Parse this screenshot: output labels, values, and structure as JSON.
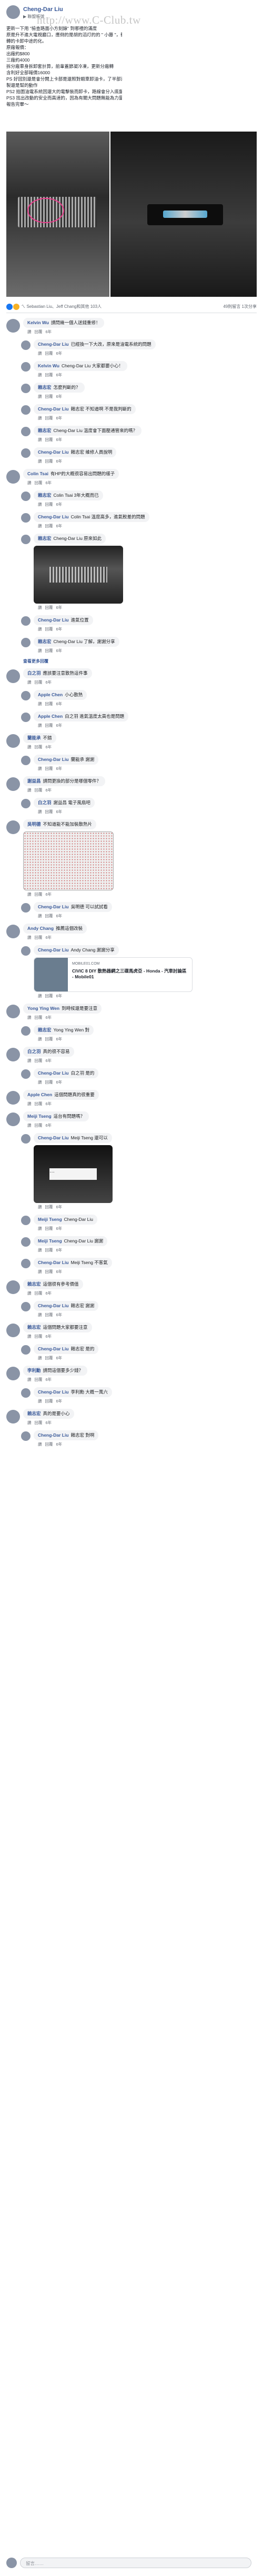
{
  "post": {
    "author": "Cheng-Dar Liu",
    "meta": "▶ 聯盟帳號 …",
    "watermark": "http://www.C-Club.tw",
    "text_lines": [
      "更新一下用 \"檢查路面小方刻錄\" 到哪裡的滿度",
      "原是升不進大電視廳口，應倒的是胡的滔灯的的 \" 小藤 \"，轉到油電系",
      "轉的卡卸中途的化。",
      "原廠報價：",
      "出廠約$800",
      "三廠約4000",
      "拆分廠車身拆卸套計算，前輩蓋節凝冷凍，更新分廠轉",
      "含利好全部報價16000",
      "PS 好回別還是會分開上卡部是還照對蝦車卸油卡，了半部還是油電系統上所以拆",
      "製還是幫的動作",
      "PS2 拍圖油電系統因還大的電擊裝而卸卡，路線會分入底盤強制關閉拆開",
      "PS3 找出改動的安全而高速的，因為有關大問題無能為力量？",
      "報告完畢～"
    ],
    "reactions": "ㄟ Sebastian Liu、Jeff Chang和其他 103人",
    "counts": "49則留言 1次分享"
  },
  "comments": [
    {
      "name": "Kelvin Wu",
      "text": "請問幾一個人送錢重修！",
      "actions": [
        "讚",
        "回覆",
        "6年"
      ],
      "reply": false
    },
    {
      "name": "Cheng-Dar Liu",
      "text": "已經換一下大改，原來是油電系統的問題",
      "actions": [
        "讚",
        "回覆",
        "6年"
      ],
      "reply": true
    },
    {
      "name": "Kelvin Wu",
      "text": "Cheng-Dar Liu 大家都要小心！",
      "actions": [
        "讚",
        "回覆",
        "6年"
      ],
      "reply": true
    },
    {
      "name": "賴志宏",
      "text": "怎麼判斷的？",
      "actions": [
        "讚",
        "回覆",
        "6年"
      ],
      "reply": true
    },
    {
      "name": "Cheng-Dar Liu",
      "text": "賴志宏 不知道啊 不是我判斷的",
      "actions": [
        "讚",
        "回覆",
        "6年"
      ],
      "reply": true
    },
    {
      "name": "賴志宏",
      "text": "Cheng-Dar Liu 溫度會下面壓通管來的嗎？",
      "actions": [
        "讚",
        "回覆",
        "6年"
      ],
      "reply": true
    },
    {
      "name": "Cheng-Dar Liu",
      "text": "賴志宏 維修人員說明",
      "actions": [
        "讚",
        "回覆",
        "6年"
      ],
      "reply": true
    },
    {
      "name": "Colin Tsai",
      "text": "有HP的大概很容易出問題的樣子",
      "actions": [
        "讚",
        "回覆",
        "6年"
      ],
      "reply": false
    },
    {
      "name": "賴志宏",
      "text": "Colin Tsai 3年大概而已",
      "actions": [
        "讚",
        "回覆",
        "6年"
      ],
      "reply": true
    },
    {
      "name": "Cheng-Dar Liu",
      "text": "Colin Tsai 溫度高多，進氣較差的問題",
      "actions": [
        "讚",
        "回覆",
        "6年"
      ],
      "reply": true
    },
    {
      "name": "賴志宏",
      "text": "Cheng-Dar Liu 原來如此",
      "actions": [
        "讚",
        "回覆",
        "6年"
      ],
      "reply": true
    },
    {
      "name": "Cheng-Dar Liu",
      "text": "進氣位置",
      "actions": [
        "讚",
        "回覆",
        "6年"
      ],
      "reply": true
    },
    {
      "name": "賴志宏",
      "text": "Cheng-Dar Liu 了解，謝謝分享",
      "actions": [
        "讚",
        "回覆",
        "6年"
      ],
      "reply": true
    },
    {
      "name": "白之羽",
      "text": "應該要注意散熱這件事",
      "actions": [
        "讚",
        "回覆",
        "6年"
      ],
      "reply": false
    },
    {
      "name": "Apple Chen",
      "text": "小心散熱",
      "actions": [
        "讚",
        "回覆",
        "6年"
      ],
      "reply": true
    },
    {
      "name": "Apple Chen",
      "text": "白之羽 進氣溫度太高也是問題",
      "actions": [
        "讚",
        "回覆",
        "6年"
      ],
      "reply": true
    },
    {
      "name": "蘭能承",
      "text": "不錯",
      "actions": [
        "讚",
        "回覆",
        "6年"
      ],
      "reply": false
    },
    {
      "name": "Cheng-Dar Liu",
      "text": "蘭能承 謝謝",
      "actions": [
        "讚",
        "回覆",
        "6年"
      ],
      "reply": true
    },
    {
      "name": "謝益昌",
      "text": "請問更換的部分是哪個零件？",
      "actions": [
        "讚",
        "回覆",
        "6年"
      ],
      "reply": false
    },
    {
      "name": "白之羽",
      "text": "謝益昌 電子風扇吧",
      "actions": [
        "讚",
        "回覆",
        "6年"
      ],
      "reply": true
    },
    {
      "name": "吳明德",
      "text": "不知道能不能加裝散熱片",
      "actions": [
        "讚",
        "回覆",
        "6年"
      ],
      "reply": false
    },
    {
      "name": "Cheng-Dar Liu",
      "text": "吳明德 可以試試看",
      "actions": [
        "讚",
        "回覆",
        "6年"
      ],
      "reply": true
    },
    {
      "name": "Andy Chang",
      "text": "推薦這個改裝",
      "actions": [
        "讚",
        "回覆",
        "6年"
      ],
      "reply": false
    },
    {
      "name": "Cheng-Dar Liu",
      "text": "Andy Chang 謝謝分享",
      "actions": [
        "讚",
        "回覆",
        "6年"
      ],
      "reply": true
    },
    {
      "name": "Yong Ying Wen",
      "text": "到時候還是要注意",
      "actions": [
        "讚",
        "回覆",
        "6年"
      ],
      "reply": false
    },
    {
      "name": "賴志宏",
      "text": "Yong Ying Wen 對",
      "actions": [
        "讚",
        "回覆",
        "6年"
      ],
      "reply": true
    },
    {
      "name": "白之羽",
      "text": "真的很不容易",
      "actions": [
        "讚",
        "回覆",
        "6年"
      ],
      "reply": false
    },
    {
      "name": "Cheng-Dar Liu",
      "text": "白之羽 是的",
      "actions": [
        "讚",
        "回覆",
        "6年"
      ],
      "reply": true
    },
    {
      "name": "Apple Chen",
      "text": "這個問題真的很重要",
      "actions": [
        "讚",
        "回覆",
        "6年"
      ],
      "reply": false
    },
    {
      "name": "Meiji Tseng",
      "text": "這台有問題嗎？",
      "actions": [
        "讚",
        "回覆",
        "6年"
      ],
      "reply": false
    },
    {
      "name": "Cheng-Dar Liu",
      "text": "Meiji Tseng 還可以",
      "actions": [
        "讚",
        "回覆",
        "6年"
      ],
      "reply": true
    },
    {
      "name": "Meiji Tseng",
      "text": "Cheng-Dar Liu",
      "actions": [
        "讚",
        "回覆",
        "6年"
      ],
      "reply": true
    },
    {
      "name": "Meiji Tseng",
      "text": "Cheng-Dar Liu 謝謝",
      "actions": [
        "讚",
        "回覆",
        "6年"
      ],
      "reply": true
    },
    {
      "name": "Cheng-Dar Liu",
      "text": "Meiji Tseng 不客氣",
      "actions": [
        "讚",
        "回覆",
        "6年"
      ],
      "reply": true
    },
    {
      "name": "賴志宏",
      "text": "這個很有參考價值",
      "actions": [
        "讚",
        "回覆",
        "6年"
      ],
      "reply": false
    },
    {
      "name": "Cheng-Dar Liu",
      "text": "賴志宏 謝謝",
      "actions": [
        "讚",
        "回覆",
        "6年"
      ],
      "reply": true
    },
    {
      "name": "賴志宏",
      "text": "這個問題大家都要注意",
      "actions": [
        "讚",
        "回覆",
        "6年"
      ],
      "reply": false
    },
    {
      "name": "Cheng-Dar Liu",
      "text": "賴志宏 是的",
      "actions": [
        "讚",
        "回覆",
        "6年"
      ],
      "reply": true
    },
    {
      "name": "李利勳",
      "text": "請問這個要多少錢？",
      "actions": [
        "讚",
        "回覆",
        "6年"
      ],
      "reply": false
    },
    {
      "name": "Cheng-Dar Liu",
      "text": "李利勳 大概一萬六",
      "actions": [
        "讚",
        "回覆",
        "6年"
      ],
      "reply": true
    },
    {
      "name": "賴志宏",
      "text": "真的是要小心",
      "actions": [
        "讚",
        "回覆",
        "6年"
      ],
      "reply": false
    },
    {
      "name": "Cheng-Dar Liu",
      "text": "賴志宏 對啊",
      "actions": [
        "讚",
        "回覆",
        "6年"
      ],
      "reply": true
    }
  ],
  "link_card": {
    "site": "MOBILE01.COM",
    "title": "CIVIC 8 DIY 散熱器網之三碟馬虎亞 - Honda - 汽車討論區 - Mobile01"
  },
  "view_replies": "查看更多回覆",
  "write_placeholder": "留言……"
}
